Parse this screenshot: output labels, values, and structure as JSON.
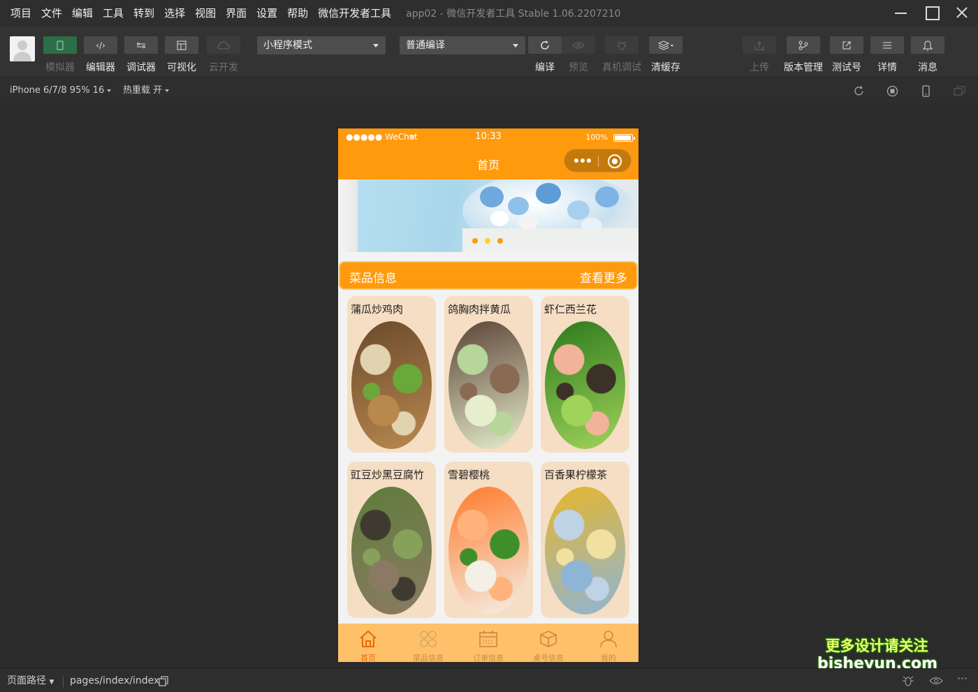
{
  "menubar": {
    "items": [
      "项目",
      "文件",
      "编辑",
      "工具",
      "转到",
      "选择",
      "视图",
      "界面",
      "设置",
      "帮助",
      "微信开发者工具"
    ],
    "title": "app02 - 微信开发者工具 Stable 1.06.2207210"
  },
  "toolbar": {
    "tools_left": [
      {
        "label": "模拟器",
        "icon": "phone-icon",
        "disabled": true
      },
      {
        "label": "编辑器",
        "icon": "code-icon",
        "disabled": false
      },
      {
        "label": "调试器",
        "icon": "debug-icon",
        "disabled": false
      },
      {
        "label": "可视化",
        "icon": "layout-icon",
        "disabled": false
      },
      {
        "label": "云开发",
        "icon": "cloud-icon",
        "disabled": true
      }
    ],
    "mode_select": "小程序模式",
    "compile_select": "普通编译",
    "tools_mid": [
      {
        "label": "编译",
        "icon": "refresh-icon",
        "disabled": false
      },
      {
        "label": "预览",
        "icon": "eye-icon",
        "disabled": true
      },
      {
        "label": "真机调试",
        "icon": "bug-icon",
        "disabled": true
      },
      {
        "label": "清缓存",
        "icon": "layers-icon",
        "disabled": false
      }
    ],
    "tools_right": [
      {
        "label": "上传",
        "icon": "upload-icon",
        "disabled": true
      },
      {
        "label": "版本管理",
        "icon": "branch-icon",
        "disabled": false
      },
      {
        "label": "测试号",
        "icon": "external-link-icon",
        "disabled": false
      },
      {
        "label": "详情",
        "icon": "menu-icon",
        "disabled": false
      },
      {
        "label": "消息",
        "icon": "bell-icon",
        "disabled": false
      }
    ]
  },
  "subbar": {
    "device": "iPhone 6/7/8 95% 16",
    "hot_reload": "热重载 开"
  },
  "phone": {
    "status": {
      "carrier": "●●●●● WeChat",
      "time": "10:33",
      "battery": "100%"
    },
    "nav_title": "首页",
    "section": {
      "title": "菜品信息",
      "more": "查看更多"
    },
    "dishes": [
      {
        "name": "蒲瓜炒鸡肉",
        "palette": [
          "#6b4a2c",
          "#e2d3b0",
          "#6aa83a",
          "#b8884f"
        ]
      },
      {
        "name": "鸽胸肉拌黄瓜",
        "palette": [
          "#5b4336",
          "#b7d69a",
          "#8a6a52",
          "#e6eecd"
        ]
      },
      {
        "name": "虾仁西兰花",
        "palette": [
          "#2e7a1e",
          "#f3b39a",
          "#3b3127",
          "#9fd35a"
        ]
      },
      {
        "name": "豇豆炒黑豆腐竹",
        "palette": [
          "#5f7d3b",
          "#3f3a30",
          "#87a05a",
          "#8b7a63"
        ]
      },
      {
        "name": "雪碧樱桃",
        "palette": [
          "#ff7a2a",
          "#ffb37a",
          "#3e8f2a",
          "#f4f0e8"
        ]
      },
      {
        "name": "百香果柠檬茶",
        "palette": [
          "#e7b62b",
          "#bfd3e6",
          "#f2e0a0",
          "#8fb5d6"
        ]
      }
    ],
    "tabs": [
      {
        "label": "首页",
        "icon": "home-icon",
        "active": true
      },
      {
        "label": "菜品信息",
        "icon": "grid-icon",
        "active": false
      },
      {
        "label": "订单信息",
        "icon": "calendar-icon",
        "active": false
      },
      {
        "label": "桌号信息",
        "icon": "box-icon",
        "active": false
      },
      {
        "label": "我的",
        "icon": "user-icon",
        "active": false
      }
    ]
  },
  "bottombar": {
    "page_path_label": "页面路径",
    "page_path": "pages/index/index"
  },
  "watermark": {
    "line1": "更多设计请关注",
    "line2": "bisheyun.com"
  },
  "colors": {
    "accent": "#ff9a0d",
    "card": "#f5dec3",
    "tabbar": "#ffc06a",
    "ide_bg": "#2e2e2e"
  }
}
